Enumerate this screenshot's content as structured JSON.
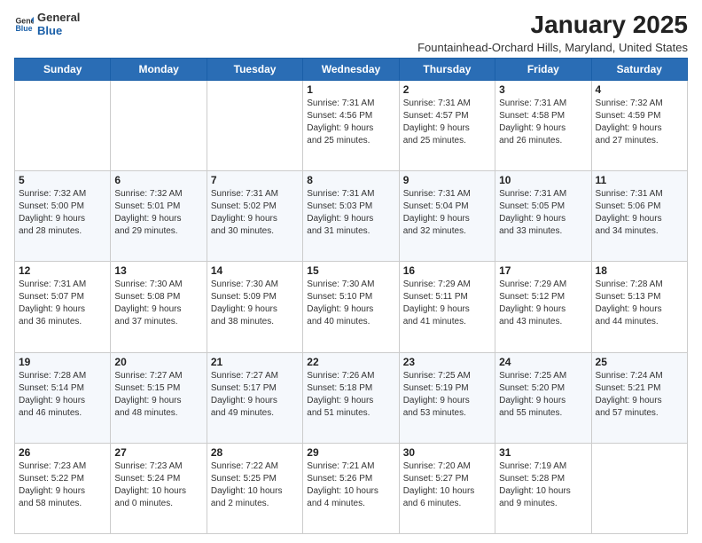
{
  "logo": {
    "line1": "General",
    "line2": "Blue"
  },
  "title": "January 2025",
  "subtitle": "Fountainhead-Orchard Hills, Maryland, United States",
  "days_header": [
    "Sunday",
    "Monday",
    "Tuesday",
    "Wednesday",
    "Thursday",
    "Friday",
    "Saturday"
  ],
  "weeks": [
    [
      {
        "day": "",
        "content": ""
      },
      {
        "day": "",
        "content": ""
      },
      {
        "day": "",
        "content": ""
      },
      {
        "day": "1",
        "content": "Sunrise: 7:31 AM\nSunset: 4:56 PM\nDaylight: 9 hours\nand 25 minutes."
      },
      {
        "day": "2",
        "content": "Sunrise: 7:31 AM\nSunset: 4:57 PM\nDaylight: 9 hours\nand 25 minutes."
      },
      {
        "day": "3",
        "content": "Sunrise: 7:31 AM\nSunset: 4:58 PM\nDaylight: 9 hours\nand 26 minutes."
      },
      {
        "day": "4",
        "content": "Sunrise: 7:32 AM\nSunset: 4:59 PM\nDaylight: 9 hours\nand 27 minutes."
      }
    ],
    [
      {
        "day": "5",
        "content": "Sunrise: 7:32 AM\nSunset: 5:00 PM\nDaylight: 9 hours\nand 28 minutes."
      },
      {
        "day": "6",
        "content": "Sunrise: 7:32 AM\nSunset: 5:01 PM\nDaylight: 9 hours\nand 29 minutes."
      },
      {
        "day": "7",
        "content": "Sunrise: 7:31 AM\nSunset: 5:02 PM\nDaylight: 9 hours\nand 30 minutes."
      },
      {
        "day": "8",
        "content": "Sunrise: 7:31 AM\nSunset: 5:03 PM\nDaylight: 9 hours\nand 31 minutes."
      },
      {
        "day": "9",
        "content": "Sunrise: 7:31 AM\nSunset: 5:04 PM\nDaylight: 9 hours\nand 32 minutes."
      },
      {
        "day": "10",
        "content": "Sunrise: 7:31 AM\nSunset: 5:05 PM\nDaylight: 9 hours\nand 33 minutes."
      },
      {
        "day": "11",
        "content": "Sunrise: 7:31 AM\nSunset: 5:06 PM\nDaylight: 9 hours\nand 34 minutes."
      }
    ],
    [
      {
        "day": "12",
        "content": "Sunrise: 7:31 AM\nSunset: 5:07 PM\nDaylight: 9 hours\nand 36 minutes."
      },
      {
        "day": "13",
        "content": "Sunrise: 7:30 AM\nSunset: 5:08 PM\nDaylight: 9 hours\nand 37 minutes."
      },
      {
        "day": "14",
        "content": "Sunrise: 7:30 AM\nSunset: 5:09 PM\nDaylight: 9 hours\nand 38 minutes."
      },
      {
        "day": "15",
        "content": "Sunrise: 7:30 AM\nSunset: 5:10 PM\nDaylight: 9 hours\nand 40 minutes."
      },
      {
        "day": "16",
        "content": "Sunrise: 7:29 AM\nSunset: 5:11 PM\nDaylight: 9 hours\nand 41 minutes."
      },
      {
        "day": "17",
        "content": "Sunrise: 7:29 AM\nSunset: 5:12 PM\nDaylight: 9 hours\nand 43 minutes."
      },
      {
        "day": "18",
        "content": "Sunrise: 7:28 AM\nSunset: 5:13 PM\nDaylight: 9 hours\nand 44 minutes."
      }
    ],
    [
      {
        "day": "19",
        "content": "Sunrise: 7:28 AM\nSunset: 5:14 PM\nDaylight: 9 hours\nand 46 minutes."
      },
      {
        "day": "20",
        "content": "Sunrise: 7:27 AM\nSunset: 5:15 PM\nDaylight: 9 hours\nand 48 minutes."
      },
      {
        "day": "21",
        "content": "Sunrise: 7:27 AM\nSunset: 5:17 PM\nDaylight: 9 hours\nand 49 minutes."
      },
      {
        "day": "22",
        "content": "Sunrise: 7:26 AM\nSunset: 5:18 PM\nDaylight: 9 hours\nand 51 minutes."
      },
      {
        "day": "23",
        "content": "Sunrise: 7:25 AM\nSunset: 5:19 PM\nDaylight: 9 hours\nand 53 minutes."
      },
      {
        "day": "24",
        "content": "Sunrise: 7:25 AM\nSunset: 5:20 PM\nDaylight: 9 hours\nand 55 minutes."
      },
      {
        "day": "25",
        "content": "Sunrise: 7:24 AM\nSunset: 5:21 PM\nDaylight: 9 hours\nand 57 minutes."
      }
    ],
    [
      {
        "day": "26",
        "content": "Sunrise: 7:23 AM\nSunset: 5:22 PM\nDaylight: 9 hours\nand 58 minutes."
      },
      {
        "day": "27",
        "content": "Sunrise: 7:23 AM\nSunset: 5:24 PM\nDaylight: 10 hours\nand 0 minutes."
      },
      {
        "day": "28",
        "content": "Sunrise: 7:22 AM\nSunset: 5:25 PM\nDaylight: 10 hours\nand 2 minutes."
      },
      {
        "day": "29",
        "content": "Sunrise: 7:21 AM\nSunset: 5:26 PM\nDaylight: 10 hours\nand 4 minutes."
      },
      {
        "day": "30",
        "content": "Sunrise: 7:20 AM\nSunset: 5:27 PM\nDaylight: 10 hours\nand 6 minutes."
      },
      {
        "day": "31",
        "content": "Sunrise: 7:19 AM\nSunset: 5:28 PM\nDaylight: 10 hours\nand 9 minutes."
      },
      {
        "day": "",
        "content": ""
      }
    ]
  ]
}
